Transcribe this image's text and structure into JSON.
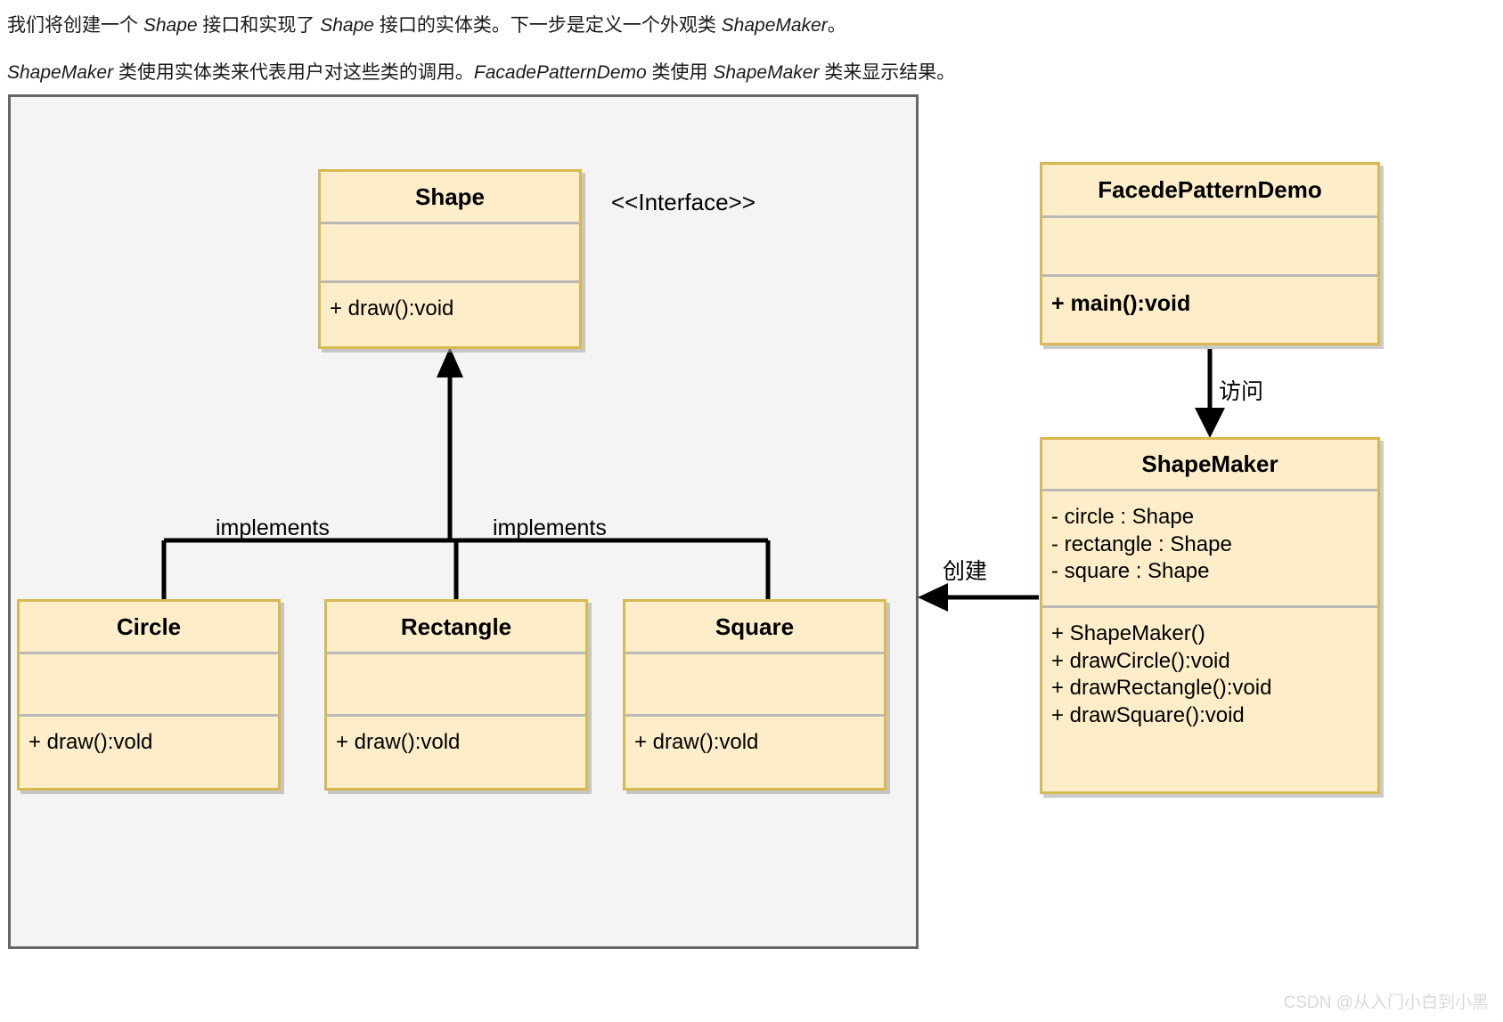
{
  "intro": {
    "line1_a": "我们将创建一个 ",
    "line1_em1": "Shape",
    "line1_b": " 接口和实现了 ",
    "line1_em2": "Shape",
    "line1_c": " 接口的实体类。下一步是定义一个外观类 ",
    "line1_em3": "ShapeMaker",
    "line1_d": "。",
    "line2_em1": "ShapeMaker",
    "line2_a": " 类使用实体类来代表用户对这些类的调用。",
    "line2_em2": "FacadePatternDemo",
    "line2_b": " 类使用 ",
    "line2_em3": "ShapeMaker",
    "line2_c": " 类来显示结果。"
  },
  "diagram": {
    "classes": {
      "shape": {
        "name": "Shape",
        "attributes": [],
        "methods": [
          "+ draw():void"
        ]
      },
      "circle": {
        "name": "Circle",
        "attributes": [],
        "methods": [
          "+ draw():vold"
        ]
      },
      "rectangle": {
        "name": "Rectangle",
        "attributes": [],
        "methods": [
          "+ draw():vold"
        ]
      },
      "square": {
        "name": "Square",
        "attributes": [],
        "methods": [
          "+ draw():vold"
        ]
      },
      "demo": {
        "name": "FacedePatternDemo",
        "attributes": [],
        "methods": [
          "+ main():void"
        ]
      },
      "maker": {
        "name": "ShapeMaker",
        "attributes": [
          "- circle : Shape",
          "- rectangle : Shape",
          "- square : Shape"
        ],
        "methods": [
          "+ ShapeMaker()",
          "+ drawCircle():void",
          "+ drawRectangle():void",
          "+ drawSquare():void"
        ]
      }
    },
    "labels": {
      "interface_stereotype": "<<Interface>>",
      "implements_left": "implements",
      "implements_right": "implements",
      "access": "访问",
      "create": "创建"
    },
    "colors": {
      "class_fill": "#fdeec9",
      "class_border": "#d8b851",
      "compartment_divider": "#b9b9b9",
      "panel_fill": "#f4f4f4",
      "panel_border": "#666666",
      "connector": "#000000",
      "watermark": "#d8d8d8"
    }
  },
  "watermark": "CSDN @从入门小白到小黑"
}
